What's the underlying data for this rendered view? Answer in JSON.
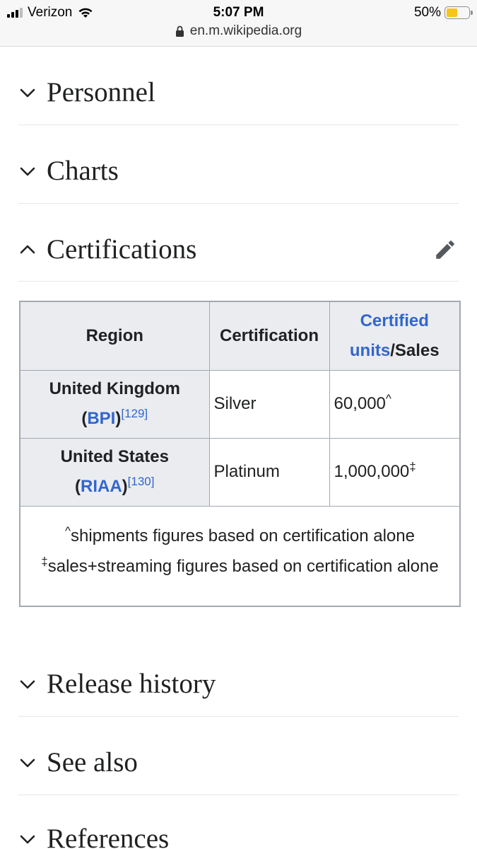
{
  "status_bar": {
    "carrier": "Verizon",
    "time": "5:07 PM",
    "battery": "50%",
    "battery_level": 0.5,
    "url": "en.m.wikipedia.org"
  },
  "sections": {
    "personnel": "Personnel",
    "charts": "Charts",
    "certifications": "Certifications",
    "release_history": "Release history",
    "see_also": "See also",
    "references": "References"
  },
  "table": {
    "headers": {
      "region": "Region",
      "certification": "Certification",
      "certified_link": "Certified",
      "units_link": "units",
      "sales": "/Sales"
    },
    "rows": [
      {
        "region": "United Kingdom",
        "open_paren": "(",
        "body": "BPI",
        "close_paren": ")",
        "ref": "[129]",
        "certification": "Silver",
        "units": "60,000",
        "marker": "^"
      },
      {
        "region": "United States",
        "open_paren": "(",
        "body": "RIAA",
        "close_paren": ")",
        "ref": "[130]",
        "certification": "Platinum",
        "units": "1,000,000",
        "marker": "‡"
      }
    ],
    "notes": {
      "shipments_marker": "^",
      "shipments": "shipments figures based on certification alone",
      "sales_marker": "‡",
      "sales": "sales+streaming figures based on certification alone"
    }
  },
  "colors": {
    "link": "#3366cc",
    "header_bg": "#eaecf0",
    "border": "#a2a9b1"
  },
  "icons": [
    "signal-icon",
    "wifi-icon",
    "battery-icon",
    "lock-icon",
    "chevron-down-icon",
    "chevron-up-icon",
    "pencil-icon"
  ]
}
